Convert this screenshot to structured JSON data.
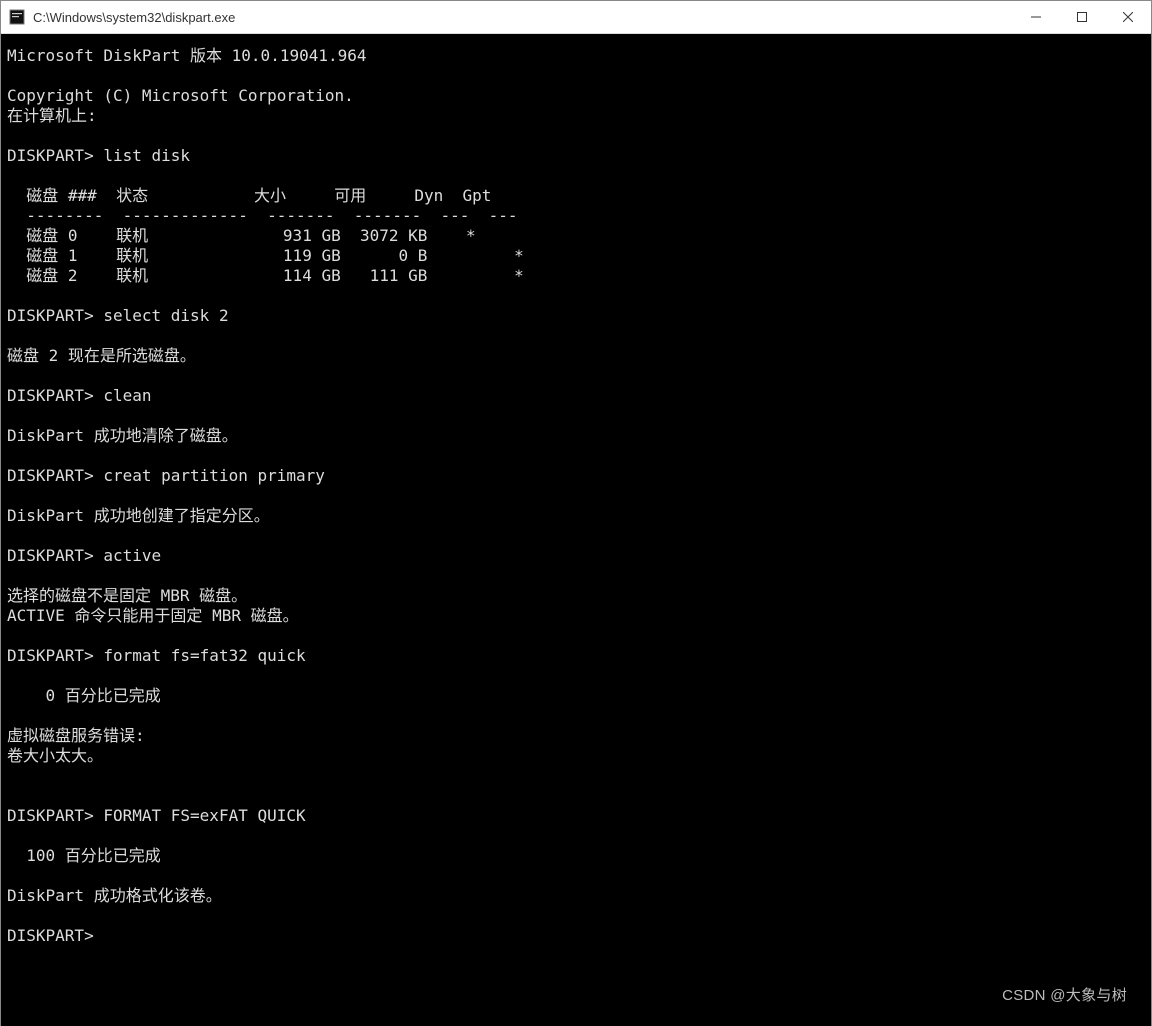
{
  "window": {
    "title": "C:\\Windows\\system32\\diskpart.exe"
  },
  "terminal": {
    "header_version": "Microsoft DiskPart 版本 10.0.19041.964",
    "copyright": "Copyright (C) Microsoft Corporation.",
    "on_computer": "在计算机上: ",
    "prompt": "DISKPART>",
    "cmd_list_disk": "list disk",
    "table_header": "  磁盘 ###  状态           大小     可用     Dyn  Gpt",
    "table_divider": "  --------  -------------  -------  -------  ---  ---",
    "disk0": "  磁盘 0    联机              931 GB  3072 KB    *",
    "disk1": "  磁盘 1    联机              119 GB      0 B         *",
    "disk2": "  磁盘 2    联机              114 GB   111 GB         *",
    "cmd_select": "select disk 2",
    "selected_msg": "磁盘 2 现在是所选磁盘。",
    "cmd_clean": "clean",
    "clean_msg": "DiskPart 成功地清除了磁盘。",
    "cmd_create": "creat partition primary",
    "create_msg": "DiskPart 成功地创建了指定分区。",
    "cmd_active": "active",
    "active_err1": "选择的磁盘不是固定 MBR 磁盘。",
    "active_err2": "ACTIVE 命令只能用于固定 MBR 磁盘。",
    "cmd_format1": "format fs=fat32 quick",
    "progress0": "    0 百分比已完成",
    "vds_err1": "虚拟磁盘服务错误:",
    "vds_err2": "卷大小太大。",
    "cmd_format2": "FORMAT FS=exFAT QUICK",
    "progress100": "  100 百分比已完成",
    "format_ok": "DiskPart 成功格式化该卷。"
  },
  "watermark": "CSDN @大象与树"
}
